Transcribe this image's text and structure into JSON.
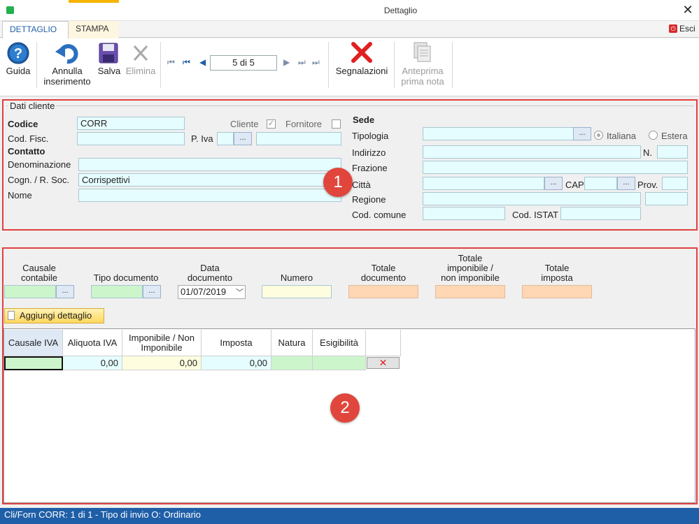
{
  "window": {
    "title": "Dettaglio",
    "close_glyph": "✕"
  },
  "tabs": [
    {
      "label": "DETTAGLIO"
    },
    {
      "label": "STAMPA"
    }
  ],
  "esci": {
    "label": "Esci"
  },
  "toolbar": {
    "guida": "Guida",
    "annulla_line1": "Annulla",
    "annulla_line2": "inserimento",
    "salva": "Salva",
    "elimina": "Elimina",
    "record_position": "5 di 5",
    "segnalazioni": "Segnalazioni",
    "anteprima_line1": "Anteprima",
    "anteprima_line2": "prima nota"
  },
  "dati_cliente": {
    "group_title": "Dati cliente",
    "codice_label": "Codice",
    "codice_value": "CORR",
    "cliente_label": "Cliente",
    "cliente_checked": true,
    "fornitore_label": "Fornitore",
    "fornitore_checked": false,
    "cod_fisc_label": "Cod. Fisc.",
    "piva_label": "P. Iva",
    "contatto_label": "Contatto",
    "denominazione_label": "Denominazione",
    "cognome_label": "Cogn. / R. Soc.",
    "cognome_value": "Corrispettivi",
    "nome_label": "Nome",
    "dots": "..."
  },
  "sede": {
    "title": "Sede",
    "tipologia_label": "Tipologia",
    "italiana_label": "Italiana",
    "estera_label": "Estera",
    "indirizzo_label": "Indirizzo",
    "n_label": "N.",
    "frazione_label": "Frazione",
    "citta_label": "Città",
    "cap_label": "CAP",
    "prov_label": "Prov.",
    "regione_label": "Regione",
    "cod_comune_label": "Cod. comune",
    "cod_istat_label": "Cod. ISTAT"
  },
  "documento": {
    "causale_contabile": [
      "Causale",
      "contabile"
    ],
    "tipo_documento": "Tipo documento",
    "data_documento": [
      "Data",
      "documento"
    ],
    "data_value": "01/07/2019",
    "numero": "Numero",
    "totale_documento": [
      "Totale",
      "documento"
    ],
    "totale_imponibile": [
      "Totale",
      "imponibile /",
      "non imponibile"
    ],
    "totale_imposta": [
      "Totale",
      "imposta"
    ],
    "aggiungi_dettaglio": "Aggiungi dettaglio"
  },
  "grid": {
    "columns": [
      "Causale IVA",
      "Aliquota IVA",
      "Imponibile / Non Imponibile",
      "Imposta",
      "Natura",
      "Esigibilità"
    ],
    "row": {
      "causale_iva": "",
      "aliquota": "0,00",
      "imponibile": "0,00",
      "imposta": "0,00",
      "natura": "",
      "esigibilita": ""
    }
  },
  "badges": {
    "one": "1",
    "two": "2"
  },
  "status_bar": "Cli/Forn CORR: 1 di 1 - Tipo di invio O: Ordinario",
  "colors": {
    "accent_blue": "#1f5fa8",
    "highlight_red": "#e04040",
    "field_cyan": "#e6fdff",
    "field_green": "#ccf5cc",
    "field_orange": "#ffd7b5"
  }
}
